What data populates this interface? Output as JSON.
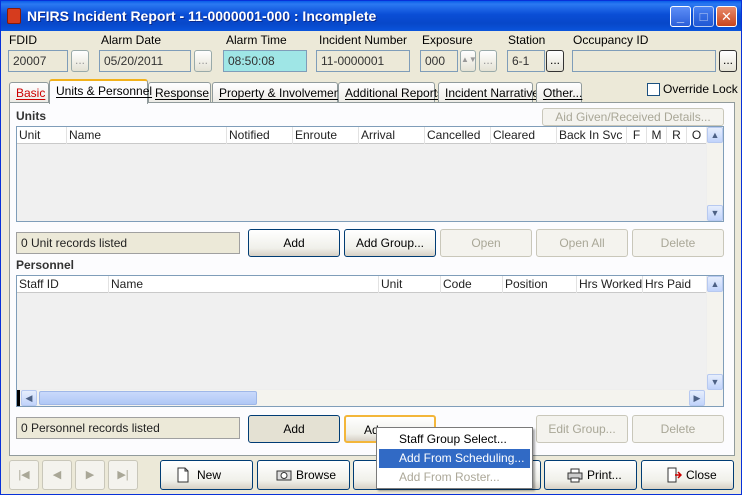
{
  "window": {
    "title": "NFIRS Incident Report  - 11-0000001-000   : Incomplete",
    "minimize_glyph": "_",
    "maximize_glyph": "□",
    "close_glyph": "✕"
  },
  "header": {
    "fdid": {
      "label": "FDID",
      "value": "20007"
    },
    "alarm_date": {
      "label": "Alarm Date",
      "value": "05/20/2011"
    },
    "alarm_time": {
      "label": "Alarm Time",
      "value": "08:50:08"
    },
    "incident_number": {
      "label": "Incident Number",
      "value": "11-0000001"
    },
    "exposure": {
      "label": "Exposure",
      "value": "000"
    },
    "station": {
      "label": "Station",
      "value": "6-1"
    },
    "occupancy_id": {
      "label": "Occupancy ID",
      "value": ""
    },
    "ellipsis": "..."
  },
  "override_lock": {
    "label": "Override Lock",
    "checked": false
  },
  "tabs": [
    {
      "label": "Basic"
    },
    {
      "label": "Units & Personnel"
    },
    {
      "label": "Response"
    },
    {
      "label": "Property & Involvement"
    },
    {
      "label": "Additional Reports"
    },
    {
      "label": "Incident Narrative"
    },
    {
      "label": "Other..."
    }
  ],
  "units": {
    "title": "Units",
    "aid_button": "Aid Given/Received Details...",
    "columns": [
      "Unit",
      "Name",
      "Notified",
      "Enroute",
      "Arrival",
      "Cancelled",
      "Cleared",
      "Back In Svc",
      "F",
      "M",
      "R",
      "O"
    ],
    "status": "0 Unit records listed",
    "buttons": {
      "add": "Add",
      "add_group": "Add Group...",
      "open": "Open",
      "open_all": "Open All",
      "delete": "Delete"
    }
  },
  "personnel": {
    "title": "Personnel",
    "columns": [
      "Staff ID",
      "Name",
      "Unit",
      "Code",
      "Position",
      "Hrs Worked",
      "Hrs Paid"
    ],
    "status": "0 Personnel records listed",
    "buttons": {
      "add": "Add",
      "add_from": "Ad",
      "edit_group": "Edit Group...",
      "delete": "Delete"
    }
  },
  "context_menu": {
    "items": [
      {
        "label": "Staff Group Select...",
        "state": "normal"
      },
      {
        "label": "Add From Scheduling...",
        "state": "highlight"
      },
      {
        "label": "Add From Roster...",
        "state": "disabled"
      }
    ]
  },
  "bottom_bar": {
    "new": "New",
    "browse": "Browse",
    "print": "Print...",
    "close": "Close",
    "nav_first": "|◀",
    "nav_prev": "◀",
    "nav_next": "▶",
    "nav_last": "▶|"
  },
  "scroll_glyphs": {
    "up": "▲",
    "down": "▼",
    "left": "◀",
    "right": "▶"
  },
  "colors": {
    "title_bar": "#0a4ed6",
    "alarm_time_bg": "#9fe6e6",
    "menu_highlight": "#316ac5",
    "tab_accent": "#f2b11b"
  }
}
